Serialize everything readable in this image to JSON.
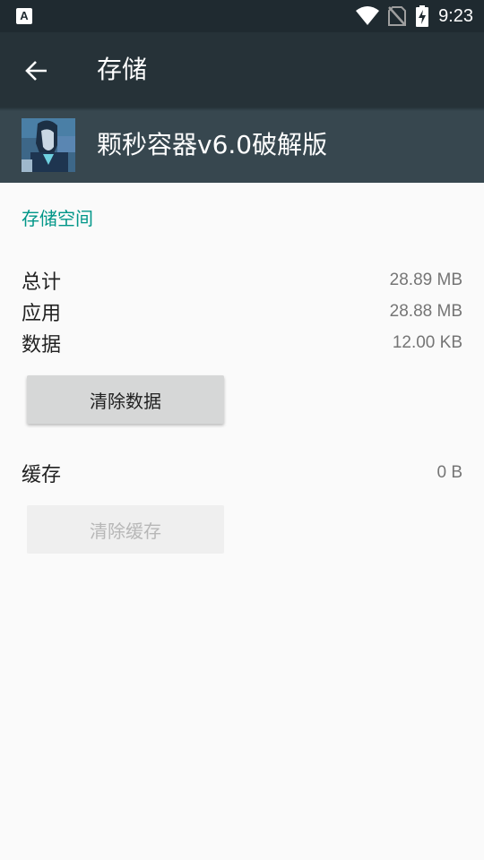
{
  "status_bar": {
    "time": "9:23",
    "icons": [
      "notification-a-icon",
      "wifi-icon",
      "no-sim-icon",
      "battery-charging-icon"
    ]
  },
  "app_bar": {
    "back_icon": "back-arrow-icon",
    "title": "存储"
  },
  "app": {
    "name": "颗秒容器v6.0破解版"
  },
  "storage": {
    "section_title": "存储空间",
    "rows": [
      {
        "label": "总计",
        "value": "28.89 MB"
      },
      {
        "label": "应用",
        "value": "28.88 MB"
      },
      {
        "label": "数据",
        "value": "12.00 KB"
      }
    ],
    "clear_data_label": "清除数据",
    "cache": {
      "label": "缓存",
      "value": "0 B"
    },
    "clear_cache_label": "清除缓存"
  },
  "colors": {
    "accent": "#009688",
    "appbar": "#263238",
    "header": "#37474f",
    "statusbar": "#1f2a30"
  }
}
